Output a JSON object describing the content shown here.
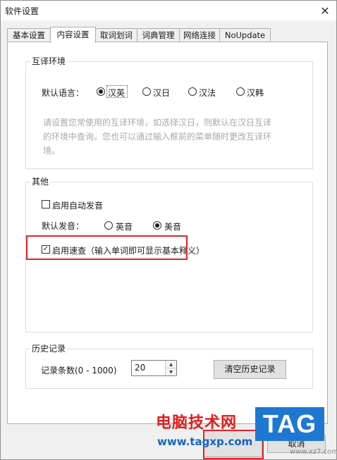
{
  "window": {
    "title": "软件设置"
  },
  "tabs": [
    {
      "label": "基本设置"
    },
    {
      "label": "内容设置"
    },
    {
      "label": "取词划词"
    },
    {
      "label": "词典管理"
    },
    {
      "label": "网络连接"
    },
    {
      "label": "NoUpdate"
    }
  ],
  "translation_env": {
    "legend": "互译环境",
    "default_language_label": "默认语言：",
    "options": [
      {
        "label": "汉英",
        "selected": true
      },
      {
        "label": "汉日",
        "selected": false
      },
      {
        "label": "汉法",
        "selected": false
      },
      {
        "label": "汉韩",
        "selected": false
      }
    ],
    "hint_lines": [
      "请设置您常使用的互译环境，如选择汉日，则默认在汉日互译",
      "的环境中查询。您也可以通过输入框前的菜单随时更改互译环",
      "境。"
    ]
  },
  "other": {
    "legend": "其他",
    "auto_pronounce_label": "启用自动发音",
    "auto_pronounce_checked": false,
    "default_pronounce_label": "默认发音：",
    "pronounce_options": [
      {
        "label": "英音",
        "selected": false
      },
      {
        "label": "美音",
        "selected": true
      }
    ],
    "quick_lookup_label": "启用速查（输入单词即可显示基本释义）",
    "quick_lookup_checked": true
  },
  "history": {
    "legend": "历史记录",
    "count_label": "记录条数(0 - 1000)",
    "count_value": "20",
    "clear_button": "清空历史记录"
  },
  "footer": {
    "right_button": "取消"
  },
  "watermark": {
    "cn": "电脑技术网",
    "url": "www.tagxp.com",
    "logo": "TAG",
    "sub": "www.xz7.com"
  },
  "colors": {
    "highlight_box": "#e0242a",
    "watermark_red": "#e01d1d",
    "watermark_blue": "#1e78d2"
  }
}
